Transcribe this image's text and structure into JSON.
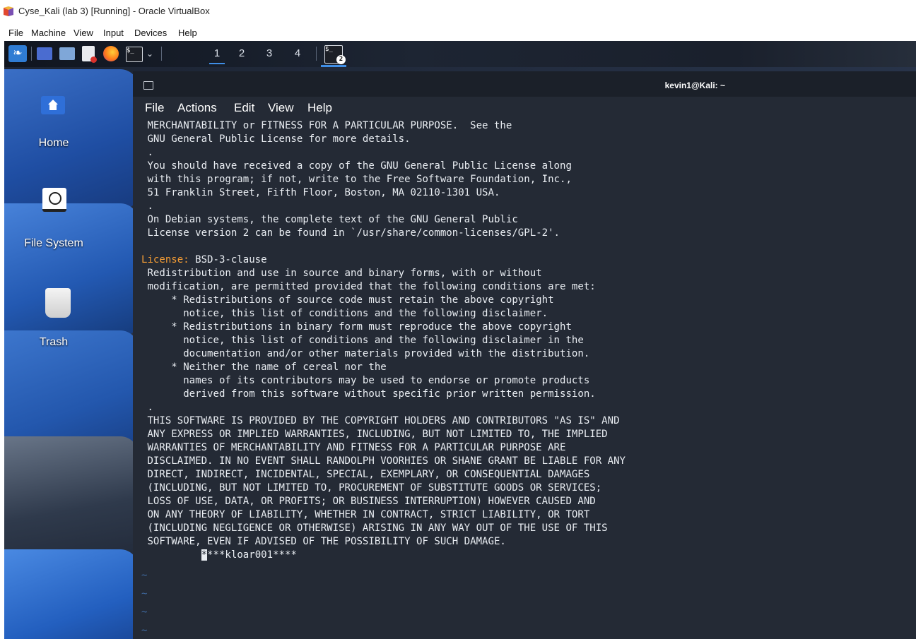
{
  "vbox": {
    "title": "Cyse_Kali (lab 3) [Running] - Oracle VirtualBox",
    "menu": [
      "File",
      "Machine",
      "View",
      "Input",
      "Devices",
      "Help"
    ]
  },
  "panel": {
    "workspaces": [
      "1",
      "2",
      "3",
      "4"
    ],
    "active_workspace": "1",
    "terminal_glyph": "$_",
    "task_badge": "2"
  },
  "desktop": {
    "icons": [
      "Home",
      "File System",
      "Trash"
    ]
  },
  "terminal": {
    "title": "kevin1@Kali: ~",
    "menu": [
      "File",
      "Actions",
      "Edit",
      "View",
      "Help"
    ],
    "lines": [
      " MERCHANTABILITY or FITNESS FOR A PARTICULAR PURPOSE.  See the",
      " GNU General Public License for more details.",
      " .",
      " You should have received a copy of the GNU General Public License along",
      " with this program; if not, write to the Free Software Foundation, Inc.,",
      " 51 Franklin Street, Fifth Floor, Boston, MA 02110-1301 USA.",
      " .",
      " On Debian systems, the complete text of the GNU General Public",
      " License version 2 can be found in `/usr/share/common-licenses/GPL-2'.",
      "",
      "License: BSD-3-clause",
      " Redistribution and use in source and binary forms, with or without",
      " modification, are permitted provided that the following conditions are met:",
      "     * Redistributions of source code must retain the above copyright",
      "       notice, this list of conditions and the following disclaimer.",
      "     * Redistributions in binary form must reproduce the above copyright",
      "       notice, this list of conditions and the following disclaimer in the",
      "       documentation and/or other materials provided with the distribution.",
      "     * Neither the name of cereal nor the",
      "       names of its contributors may be used to endorse or promote products",
      "       derived from this software without specific prior written permission.",
      " .",
      " THIS SOFTWARE IS PROVIDED BY THE COPYRIGHT HOLDERS AND CONTRIBUTORS \"AS IS\" AND",
      " ANY EXPRESS OR IMPLIED WARRANTIES, INCLUDING, BUT NOT LIMITED TO, THE IMPLIED",
      " WARRANTIES OF MERCHANTABILITY AND FITNESS FOR A PARTICULAR PURPOSE ARE",
      " DISCLAIMED. IN NO EVENT SHALL RANDOLPH VOORHIES OR SHANE GRANT BE LIABLE FOR ANY",
      " DIRECT, INDIRECT, INCIDENTAL, SPECIAL, EXEMPLARY, OR CONSEQUENTIAL DAMAGES",
      " (INCLUDING, BUT NOT LIMITED TO, PROCUREMENT OF SUBSTITUTE GOODS OR SERVICES;",
      " LOSS OF USE, DATA, OR PROFITS; OR BUSINESS INTERRUPTION) HOWEVER CAUSED AND",
      " ON ANY THEORY OF LIABILITY, WHETHER IN CONTRACT, STRICT LIABILITY, OR TORT",
      " (INCLUDING NEGLIGENCE OR OTHERWISE) ARISING IN ANY WAY OUT OF THE USE OF THIS",
      " SOFTWARE, EVEN IF ADVISED OF THE POSSIBILITY OF SUCH DAMAGE."
    ],
    "license_key": "License:",
    "license_value": " BSD-3-clause",
    "cursor_line_indent": "          ",
    "cursor_char": "*",
    "cursor_line_rest": "***kloar001****",
    "tildes": [
      "~",
      "~",
      "~",
      "~",
      "~"
    ]
  }
}
